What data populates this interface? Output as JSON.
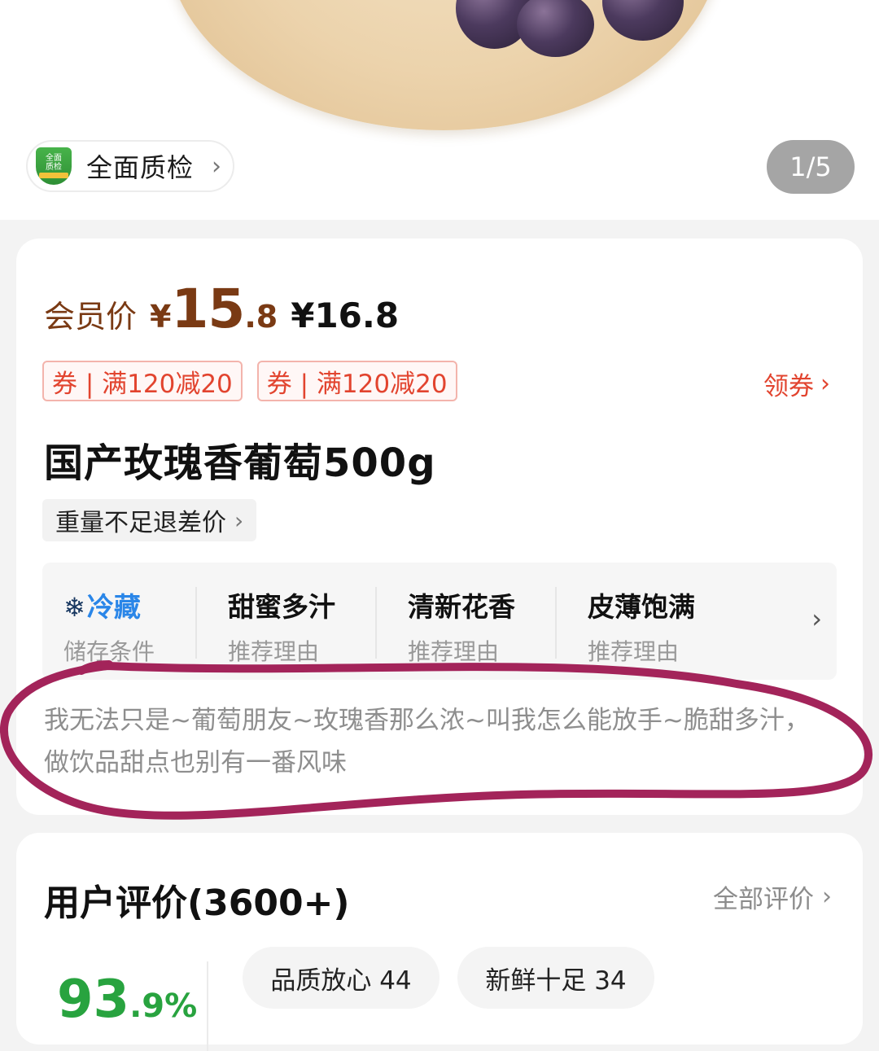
{
  "hero": {
    "quality_check_label": "全面质检",
    "page_indicator": "1/5"
  },
  "product": {
    "member_price_label": "会员价",
    "currency_symbol": "¥",
    "member_price_integer": "15",
    "member_price_decimal": ".8",
    "original_price": "¥16.8",
    "coupons": [
      {
        "label": "券 | 满120减20"
      },
      {
        "label": "券 | 满120减20"
      }
    ],
    "get_coupon_label": "领券",
    "title": "国产玫瑰香葡萄500g",
    "refund_tag": "重量不足退差价",
    "features": [
      {
        "title": "冷藏",
        "subtitle": "储存条件",
        "icon": "snowflake-icon"
      },
      {
        "title": "甜蜜多汁",
        "subtitle": "推荐理由"
      },
      {
        "title": "清新花香",
        "subtitle": "推荐理由"
      },
      {
        "title": "皮薄饱满",
        "subtitle": "推荐理由"
      }
    ],
    "description": "我无法只是~葡萄朋友~玫瑰香那么浓~叫我怎么能放手~脆甜多汁，做饮品甜点也别有一番风味"
  },
  "reviews": {
    "title": "用户评价(3600+)",
    "all_reviews_label": "全部评价",
    "rate_integer": "93",
    "rate_decimal": ".9%",
    "tags": [
      {
        "label": "品质放心 44"
      },
      {
        "label": "新鲜十足 34"
      }
    ]
  },
  "colors": {
    "price_brown": "#7a3a14",
    "coupon_red": "#e2442f",
    "storage_blue": "#2a86e8",
    "rating_green": "#28a33f",
    "annotation_magenta": "#a3245a"
  }
}
